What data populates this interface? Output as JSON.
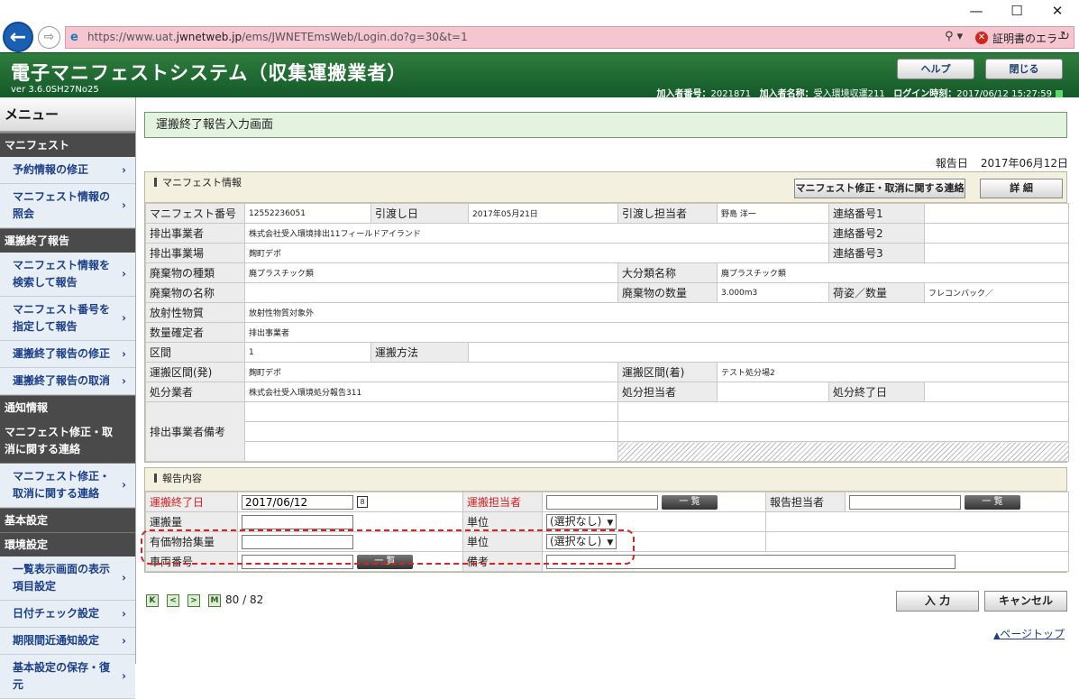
{
  "browser": {
    "url_prefix": "https://www.uat.",
    "url_domain": "jwnetweb.jp",
    "url_path": "/ems/JWNETEmsWeb/Login.do?g=30&t=1",
    "cert_error": "証明書のエラー",
    "minimize_glyph": "—",
    "maximize_glyph": "☐",
    "close_glyph": "✕"
  },
  "app": {
    "title": "電子マニフェストシステム（収集運搬業者）",
    "version": "ver 3.6.0SH27No25",
    "help_button": "ヘルプ",
    "close_button": "閉じる",
    "member_no_label": "加入者番号：",
    "member_no": "2021871",
    "member_name_label": "加入者名称：",
    "member_name": "受入環境収運211",
    "login_time_label": "ログイン時刻：",
    "login_time": "2017/06/12 15:27:59"
  },
  "sidebar": {
    "title": "メニュー",
    "sections": [
      {
        "label": "マニフェスト",
        "items": [
          "予約情報の修正",
          "マニフェスト情報の照会"
        ]
      },
      {
        "label": "運搬終了報告",
        "items": [
          "マニフェスト情報を検索して報告",
          "マニフェスト番号を指定して報告",
          "運搬終了報告の修正",
          "運搬終了報告の取消"
        ]
      },
      {
        "label": "通知情報",
        "items": []
      },
      {
        "label": "マニフェスト修正・取消に関する連絡",
        "plain": true,
        "items": [
          "マニフェスト修正・取消に関する連絡"
        ]
      },
      {
        "label": "基本設定",
        "items": []
      },
      {
        "label": "環境設定",
        "items": [
          "一覧表示画面の表示項目設定",
          "日付チェック設定",
          "期限間近通知設定",
          "基本設定の保存・復元"
        ]
      }
    ]
  },
  "page": {
    "title": "運搬終了報告入力画面",
    "report_date_label": "報告日",
    "report_date": "2017年06月12日"
  },
  "manifest": {
    "title": "マニフェスト情報",
    "contact_button": "マニフェスト修正・取消に関する連絡",
    "detail_button": "詳 細",
    "labels": {
      "manifest_no": "マニフェスト番号",
      "handover_date": "引渡し日",
      "handover_person": "引渡し担当者",
      "contact1": "連絡番号1",
      "discharger": "排出事業者",
      "contact2": "連絡番号2",
      "discharge_site": "排出事業場",
      "contact3": "連絡番号3",
      "waste_type": "廃棄物の種類",
      "category": "大分類名称",
      "waste_name": "廃棄物の名称",
      "waste_qty": "廃棄物の数量",
      "package": "荷姿／数量",
      "radioactive": "放射性物質",
      "qty_confirmer": "数量確定者",
      "section": "区間",
      "transport_method": "運搬方法",
      "from": "運搬区間(発)",
      "to": "運搬区間(着)",
      "disposer": "処分業者",
      "disposal_person": "処分担当者",
      "disposal_end": "処分終了日",
      "remarks": "排出事業者備考"
    },
    "values": {
      "manifest_no": "12552236051",
      "handover_date": "2017年05月21日",
      "handover_person": "野島 洋一",
      "discharger": "株式会社受入環境排出11フィールドアイランド",
      "discharge_site": "麹町デポ",
      "waste_type": "廃プラスチック類",
      "category": "廃プラスチック類",
      "waste_qty": "3.000m3",
      "package": "フレコンバック／",
      "radioactive": "放射性物質対象外",
      "qty_confirmer": "排出事業者",
      "section": "1",
      "from": "麹町デポ",
      "to": "テスト処分場2",
      "disposer": "株式会社受入環境処分報告311"
    }
  },
  "report": {
    "title": "報告内容",
    "end_date_label": "運搬終了日",
    "end_date": "2017/06/12",
    "calendar_glyph": "8",
    "person_label": "運搬担当者",
    "list_button": "一 覧",
    "reporter_label": "報告担当者",
    "qty_label": "運搬量",
    "unit_label": "単位",
    "unit_value": "(選択なし)",
    "valuable_label": "有価物拾集量",
    "vehicle_label": "車両番号",
    "note_label": "備考"
  },
  "pagination": {
    "first": "K",
    "prev": "<",
    "next": ">",
    "last": "M",
    "current": "80",
    "separator": "/",
    "total": "82"
  },
  "footer": {
    "input_button": "入 力",
    "cancel_button": "キャンセル",
    "page_top": "ページトップ",
    "page_top_arrow": "▲"
  }
}
